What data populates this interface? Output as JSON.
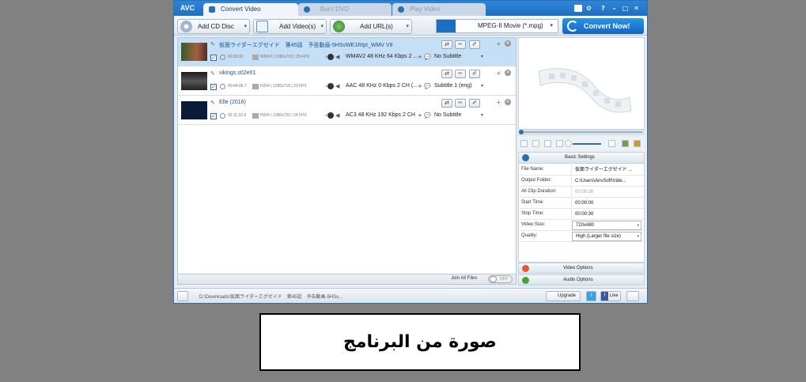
{
  "app": {
    "logo": "AVC"
  },
  "tabs": [
    {
      "label": "Convert Video",
      "active": true
    },
    {
      "label": "Burn DVD",
      "active": false
    },
    {
      "label": "Play Video",
      "active": false
    }
  ],
  "toolbar": {
    "add_cd": "Add CD Disc",
    "add_video": "Add Video(s)",
    "add_url": "Add URL(s)",
    "format": "MPEG-II Movie (*.mpg)",
    "convert": "Convert Now!"
  },
  "files": [
    {
      "name": "仮面ライダーエグゼイド　第45話　予告動画-5HSvWE1RIpI_WMV V8",
      "duration": "00:00:30",
      "video": "WMV3 | 1280x720 | 29 FPS",
      "audio": "WMAV2 48 KHz 64 Kbps 2 ...",
      "subtitle": "No Subtitle"
    },
    {
      "name": "vikings.s02e01",
      "duration": "00:44:06.7",
      "video": "H264 | 1280x718 | 23 FPS",
      "audio": "AAC 48 KHz 0 Kbps 2 CH (...",
      "subtitle": "Subtitle 1 (eng)"
    },
    {
      "name": "Elle (2016)",
      "duration": "02:11:10.9",
      "video": "H264 | 1280x720 | 24 FPS",
      "audio": "AC3 48 KHz 192 Kbps 2 CH",
      "subtitle": "No Subtitle"
    }
  ],
  "join": {
    "label": "Join All Files",
    "toggle": "OFF"
  },
  "settings": {
    "header": "Basic Settings",
    "rows": [
      {
        "label": "File Name:",
        "value": "仮面ライダーエグゼイド ..."
      },
      {
        "label": "Output Folder:",
        "value": "C:\\Users\\AnvSoft\\Vide..."
      },
      {
        "label": "All Clip Duration:",
        "value": "00:00:30"
      },
      {
        "label": "Start Time:",
        "value": "00:00:00"
      },
      {
        "label": "Stop Time:",
        "value": "00:00:30"
      },
      {
        "label": "Video Size:",
        "value": "720x480"
      },
      {
        "label": "Quality:",
        "value": "High (Larger file size)"
      }
    ],
    "video_options": "Video Options",
    "audio_options": "Audio Options"
  },
  "status": {
    "path": "D:\\Downloads\\仮面ライダーエグゼイド　第45話　予告動画-5HSv...",
    "upgrade": "Upgrade",
    "like": "Like",
    "fb": "f"
  },
  "caption": "صورة من البرنامج",
  "colors": {
    "accent": "#1f6fc0",
    "selected_row": "#c5dff6",
    "background": "#818181"
  }
}
